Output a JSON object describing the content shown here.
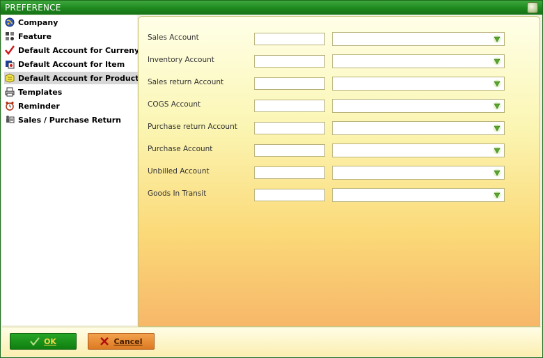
{
  "window": {
    "title": "PREFERENCE"
  },
  "sidebar": {
    "items": [
      {
        "label": "Company",
        "icon": "globe-icon"
      },
      {
        "label": "Feature",
        "icon": "feature-icon"
      },
      {
        "label": "Default Account for Curreny",
        "icon": "checkmark-icon"
      },
      {
        "label": "Default Account for Item",
        "icon": "item-icon"
      },
      {
        "label": "Default Account for Production",
        "icon": "production-icon",
        "selected": true
      },
      {
        "label": "Templates",
        "icon": "printer-icon"
      },
      {
        "label": "Reminder",
        "icon": "alarm-clock-icon"
      },
      {
        "label": "Sales / Purchase Return",
        "icon": "return-icon"
      }
    ]
  },
  "form": {
    "fields": [
      {
        "label": "Sales Account",
        "code": "",
        "account": ""
      },
      {
        "label": "Inventory Account",
        "code": "",
        "account": ""
      },
      {
        "label": "Sales return Account",
        "code": "",
        "account": ""
      },
      {
        "label": "COGS Account",
        "code": "",
        "account": ""
      },
      {
        "label": "Purchase return Account",
        "code": "",
        "account": ""
      },
      {
        "label": "Purchase Account",
        "code": "",
        "account": ""
      },
      {
        "label": "Unbilled Account",
        "code": "",
        "account": ""
      },
      {
        "label": "Goods In Transit",
        "code": "",
        "account": ""
      }
    ]
  },
  "footer": {
    "ok_label": "OK",
    "cancel_label": "Cancel"
  },
  "colors": {
    "titlebar": "#1f8a1f",
    "ok_button": "#149214",
    "cancel_button": "#e7892f",
    "dropdown_arrow": "#5aa52e"
  }
}
